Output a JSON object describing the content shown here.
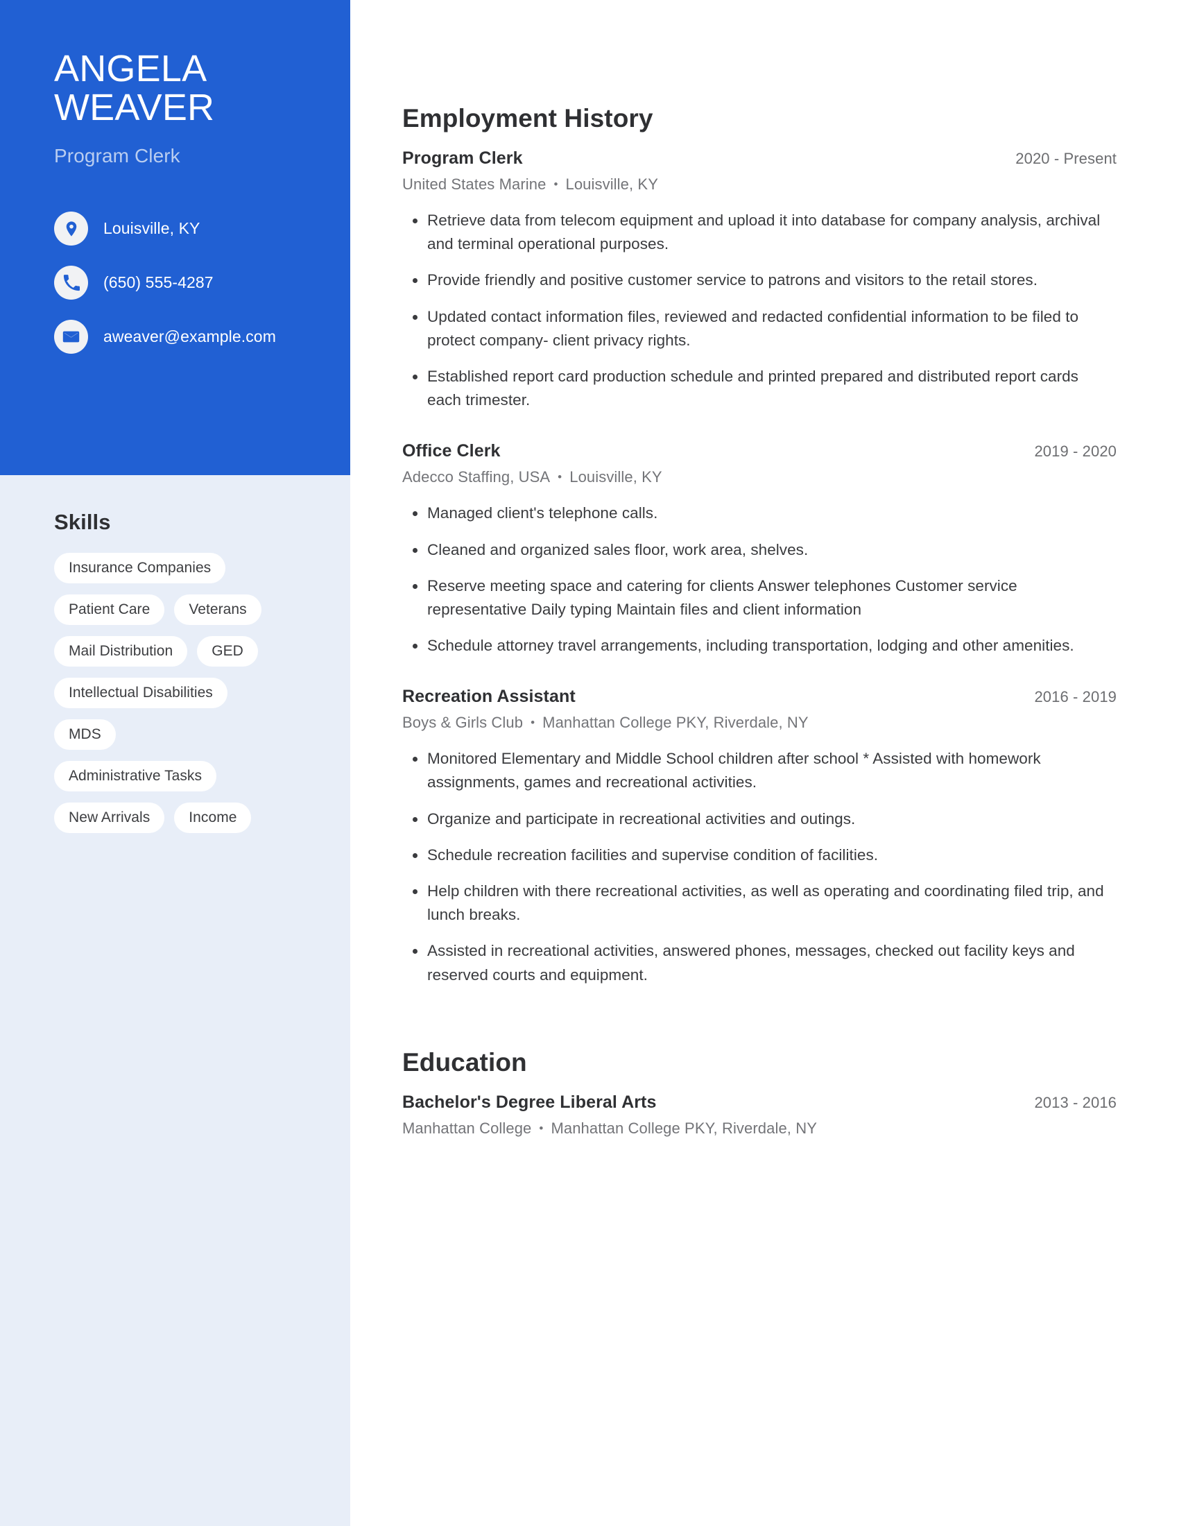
{
  "theme": {
    "accent": "#2160d3",
    "sidebar_bg": "#e8eef8",
    "pill_bg": "#ffffff",
    "subtitle": "#b9cdf0",
    "heading": "#2f3033",
    "body_text": "#3a3b3e",
    "muted_text": "#737478"
  },
  "sidebar": {
    "first_name": "ANGELA",
    "last_name": "WEAVER",
    "job_title": "Program Clerk",
    "contacts": [
      {
        "icon": "location-pin-icon",
        "text": "Louisville, KY"
      },
      {
        "icon": "phone-icon",
        "text": "(650) 555-4287"
      },
      {
        "icon": "envelope-icon",
        "text": "aweaver@example.com"
      }
    ],
    "skills_title": "Skills",
    "skill_rows": [
      [
        "Insurance Companies"
      ],
      [
        "Patient Care",
        "Veterans"
      ],
      [
        "Mail Distribution",
        "GED"
      ],
      [
        "Intellectual Disabilities"
      ],
      [
        "MDS"
      ],
      [
        "Administrative Tasks"
      ],
      [
        "New Arrivals",
        "Income"
      ]
    ]
  },
  "main": {
    "employment_title": "Employment History",
    "education_title": "Education",
    "separator": "•",
    "jobs": [
      {
        "role": "Program Clerk",
        "dates": "2020 - Present",
        "company": "United States Marine",
        "location": "Louisville, KY",
        "bullets": [
          "Retrieve data from telecom equipment and upload it into database for company analysis, archival and terminal operational purposes.",
          "Provide friendly and positive customer service to patrons and visitors to the retail stores.",
          "Updated contact information files, reviewed and redacted confidential information to be filed to protect company- client privacy rights.",
          "Established report card production schedule and printed prepared and distributed report cards each trimester."
        ]
      },
      {
        "role": "Office Clerk",
        "dates": "2019 - 2020",
        "company": "Adecco Staffing, USA",
        "location": "Louisville, KY",
        "bullets": [
          "Managed client's telephone calls.",
          "Cleaned and organized sales floor, work area, shelves.",
          "Reserve meeting space and catering for clients Answer telephones Customer service representative Daily typing Maintain files and client information",
          "Schedule attorney travel arrangements, including transportation, lodging and other amenities."
        ]
      },
      {
        "role": "Recreation Assistant",
        "dates": "2016 - 2019",
        "company": "Boys & Girls Club",
        "location": "Manhattan College PKY, Riverdale, NY",
        "bullets": [
          "Monitored Elementary and Middle School children after school * Assisted with homework assignments, games and recreational activities.",
          "Organize and participate in recreational activities and outings.",
          "Schedule recreation facilities and supervise condition of facilities.",
          "Help children with there recreational activities, as well as operating and coordinating filed trip, and lunch breaks.",
          "Assisted in recreational activities, answered phones, messages, checked out facility keys and reserved courts and equipment."
        ]
      }
    ],
    "education": [
      {
        "degree": "Bachelor's Degree Liberal Arts",
        "dates": "2013 - 2016",
        "school": "Manhattan College",
        "location": "Manhattan College PKY, Riverdale, NY"
      }
    ]
  }
}
